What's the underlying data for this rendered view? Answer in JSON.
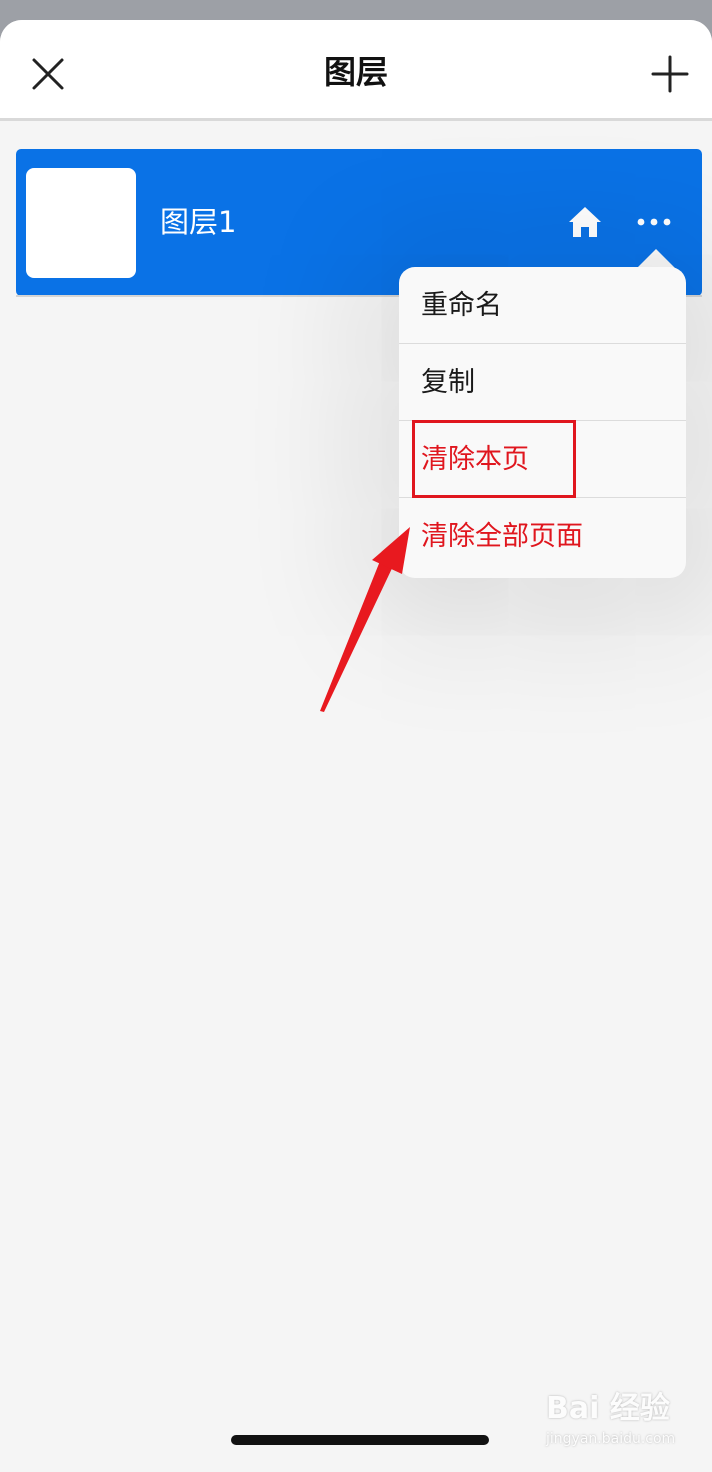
{
  "header": {
    "title": "图层",
    "close_icon": "close-icon",
    "add_icon": "plus-icon"
  },
  "layer": {
    "name": "图层1",
    "home_icon": "home-icon",
    "more_icon": "more-dots-icon",
    "selected": true
  },
  "menu": {
    "items": [
      {
        "label": "重命名",
        "destructive": false
      },
      {
        "label": "复制",
        "destructive": false
      },
      {
        "label": "清除本页",
        "destructive": true,
        "highlighted": true
      },
      {
        "label": "清除全部页面",
        "destructive": true
      }
    ]
  },
  "watermark": {
    "brand": "Bai 经验",
    "url": "jingyan.baidu.com"
  },
  "colors": {
    "accent": "#0a72e6",
    "destructive": "#e0161e",
    "annotation": "#e0161e",
    "background": "#f5f5f5"
  }
}
